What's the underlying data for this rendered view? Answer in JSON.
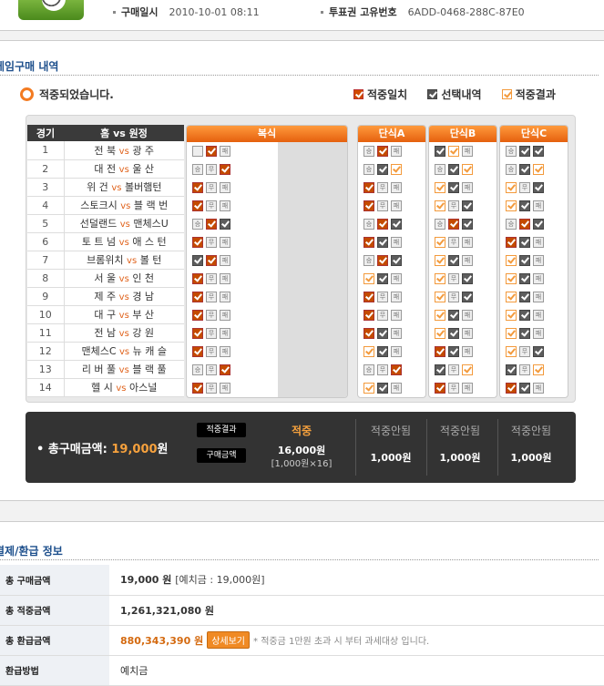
{
  "header": {
    "purchase_label": "구매일시",
    "purchase_value": "2010-10-01  08:11",
    "ticket_label": "투표권 고유번호",
    "ticket_value": "6ADD-0468-288C-87E0"
  },
  "section1": {
    "title": "게임구매 내역",
    "status": "적중되었습니다.",
    "legend": [
      "적중일치",
      "선택내역",
      "적중결과"
    ]
  },
  "match_table": {
    "col_no": "경기",
    "col_teams": "홈  vs  원정",
    "vs": "vs",
    "rows": [
      {
        "no": "1",
        "home": "전 북",
        "away": "광 주"
      },
      {
        "no": "2",
        "home": "대 전",
        "away": "울 산"
      },
      {
        "no": "3",
        "home": "위 건",
        "away": "볼버햄턴"
      },
      {
        "no": "4",
        "home": "스토크시",
        "away": "블 랙 번"
      },
      {
        "no": "5",
        "home": "선덜랜드",
        "away": "맨체스U"
      },
      {
        "no": "6",
        "home": "토 트 넘",
        "away": "애 스 턴"
      },
      {
        "no": "7",
        "home": "브롬위치",
        "away": "볼 턴"
      },
      {
        "no": "8",
        "home": "서 울",
        "away": "인 천"
      },
      {
        "no": "9",
        "home": "제 주",
        "away": "경 남"
      },
      {
        "no": "10",
        "home": "대 구",
        "away": "부 산"
      },
      {
        "no": "11",
        "home": "전 남",
        "away": "강 원"
      },
      {
        "no": "12",
        "home": "맨체스C",
        "away": "뉴 캐 슬"
      },
      {
        "no": "13",
        "home": "리 버 풀",
        "away": "블 랙 풀"
      },
      {
        "no": "14",
        "home": "헬 시",
        "away": "아스널"
      }
    ]
  },
  "columns": [
    {
      "title": "복식",
      "rows": [
        [
          "g",
          "on",
          "s:패"
        ],
        [
          "s:승",
          "s:무",
          "on"
        ],
        [
          "on",
          "s:무",
          "s:패"
        ],
        [
          "on",
          "s:무",
          "s:패"
        ],
        [
          "s:승",
          "on",
          "gy"
        ],
        [
          "on",
          "s:무",
          "s:패"
        ],
        [
          "gy",
          "on",
          "s:패"
        ],
        [
          "on",
          "s:무",
          "s:패"
        ],
        [
          "on",
          "s:무",
          "s:패"
        ],
        [
          "on",
          "s:무",
          "s:패"
        ],
        [
          "on",
          "s:무",
          "s:패"
        ],
        [
          "on",
          "s:무",
          "s:패"
        ],
        [
          "s:승",
          "s:무",
          "on"
        ],
        [
          "on",
          "s:무",
          "s:패"
        ]
      ]
    },
    {
      "title": "단식A",
      "rows": [
        [
          "s:승",
          "on",
          "s:패"
        ],
        [
          "s:승",
          "gy",
          "ow"
        ],
        [
          "on",
          "s:무",
          "s:패"
        ],
        [
          "on",
          "s:무",
          "s:패"
        ],
        [
          "s:승",
          "on",
          "gy"
        ],
        [
          "on",
          "gy",
          "s:패"
        ],
        [
          "s:승",
          "on",
          "gy"
        ],
        [
          "ow",
          "gy",
          "s:패"
        ],
        [
          "on",
          "s:무",
          "s:패"
        ],
        [
          "on",
          "s:무",
          "s:패"
        ],
        [
          "on",
          "gy",
          "s:패"
        ],
        [
          "ow",
          "gy",
          "s:패"
        ],
        [
          "s:승",
          "s:무",
          "on"
        ],
        [
          "ow",
          "gy",
          "s:패"
        ]
      ]
    },
    {
      "title": "단식B",
      "rows": [
        [
          "gy",
          "ow",
          "s:패"
        ],
        [
          "s:승",
          "gy",
          "ow"
        ],
        [
          "ow",
          "gy",
          "s:패"
        ],
        [
          "ow",
          "s:무",
          "gy"
        ],
        [
          "s:승",
          "on",
          "gy"
        ],
        [
          "ow",
          "s:무",
          "s:패"
        ],
        [
          "ow",
          "gy",
          "s:패"
        ],
        [
          "ow",
          "s:무",
          "gy"
        ],
        [
          "ow",
          "s:무",
          "gy"
        ],
        [
          "ow",
          "gy",
          "s:패"
        ],
        [
          "ow",
          "gy",
          "s:패"
        ],
        [
          "on",
          "gy",
          "s:패"
        ],
        [
          "gy",
          "s:무",
          "ow"
        ],
        [
          "on",
          "s:무",
          "s:패"
        ]
      ]
    },
    {
      "title": "단식C",
      "rows": [
        [
          "s:승",
          "gy",
          "gy"
        ],
        [
          "s:승",
          "gy",
          "ow"
        ],
        [
          "ow",
          "s:무",
          "gy"
        ],
        [
          "ow",
          "gy",
          "s:패"
        ],
        [
          "s:승",
          "on",
          "gy"
        ],
        [
          "on",
          "gy",
          "s:패"
        ],
        [
          "ow",
          "gy",
          "s:패"
        ],
        [
          "ow",
          "gy",
          "s:패"
        ],
        [
          "ow",
          "gy",
          "s:패"
        ],
        [
          "ow",
          "gy",
          "s:패"
        ],
        [
          "ow",
          "gy",
          "s:패"
        ],
        [
          "ow",
          "s:무",
          "gy"
        ],
        [
          "gy",
          "s:무",
          "ow"
        ],
        [
          "on",
          "gy",
          "s:패"
        ]
      ]
    }
  ],
  "summary": {
    "total_label": "총구매금액:",
    "total_amount": "19,000",
    "total_unit": "원",
    "tag_result": "적중결과",
    "tag_purchase": "구매금액",
    "results": [
      {
        "head": "적중",
        "value": "16,000원",
        "sub": "[1,000원×16]"
      },
      {
        "head": "적중안됨",
        "value": "1,000원"
      },
      {
        "head": "적중안됨",
        "value": "1,000원"
      },
      {
        "head": "적중안됨",
        "value": "1,000원"
      }
    ]
  },
  "section2": {
    "title": "결제/환급 정보"
  },
  "info": [
    {
      "label": "총 구매금액",
      "value": "19,000 원",
      "extra": "[예치금 : 19,000원]"
    },
    {
      "label": "총 적중금액",
      "value": "1,261,321,080 원"
    },
    {
      "label": "총 환급금액",
      "value": "880,343,390 원",
      "button": "상세보기",
      "note": "* 적중금 1만원 초과 시 부터 과세대상 입니다."
    },
    {
      "label": "환급방법",
      "value": "예치금"
    }
  ]
}
